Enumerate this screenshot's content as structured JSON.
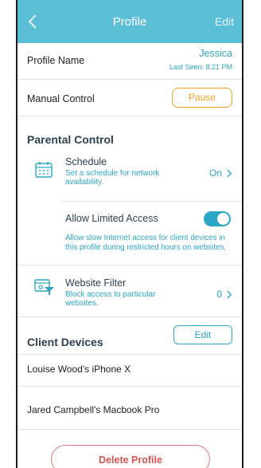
{
  "header": {
    "title": "Profile",
    "edit_label": "Edit"
  },
  "profile": {
    "name_label": "Profile Name",
    "name_value": "Jessica",
    "last_seen": "Last Seen: 8:21 PM"
  },
  "manual": {
    "label": "Manual Control",
    "button_label": "Pause"
  },
  "parental": {
    "title": "Parental Control",
    "schedule": {
      "title": "Schedule",
      "description_line1": "Set a schedule for network",
      "description_line2": "availability.",
      "status": "On"
    },
    "limited": {
      "title": "Allow Limited Access",
      "description_line1": "Allow slow Internet access for client devices in",
      "description_line2": "this profile during restricted hours on websites."
    },
    "filter": {
      "title": "Website Filter",
      "description_line1": "Block access to particular",
      "description_line2": "websites.",
      "count": "0"
    }
  },
  "clients": {
    "title": "Client Devices",
    "edit_label": "Edit",
    "devices": [
      "Louise Wood's iPhone X",
      "Jared Campbell's Macbook Pro"
    ]
  },
  "delete_label": "Delete Profile",
  "colors": {
    "accent": "#2ba6c4",
    "header": "#5bbfd6",
    "warning": "#f0a21e",
    "danger": "#d9534f"
  }
}
